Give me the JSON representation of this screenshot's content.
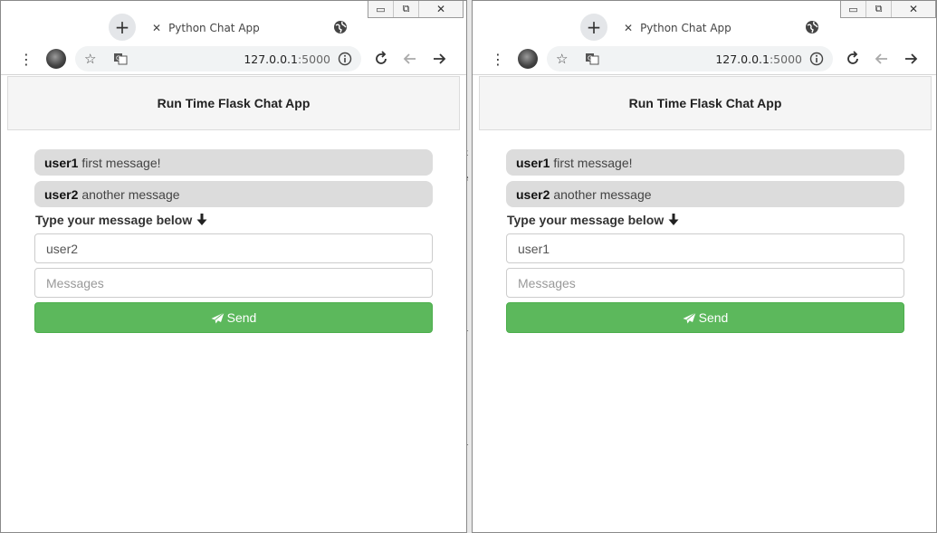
{
  "gap": {
    "ghost_text": [
      "k",
      "e",
      "1",
      "1"
    ]
  },
  "windows": [
    {
      "window_controls": {
        "minimize": "▭",
        "restore": "⧉",
        "close": "✕"
      },
      "tab": {
        "title": "Python Chat App",
        "close": "✕",
        "new_tab": "+"
      },
      "toolbar": {
        "url_host": "127.0.0.1",
        "url_port": ":5000",
        "menu": "⋮",
        "star": "☆"
      },
      "app": {
        "header": "Run Time Flask Chat App",
        "messages": [
          {
            "user": "user1",
            "text": "first message!"
          },
          {
            "user": "user2",
            "text": "another message"
          }
        ],
        "prompt": "Type your message below",
        "username_value": "user2",
        "message_placeholder": "Messages",
        "send_label": "Send"
      }
    },
    {
      "window_controls": {
        "minimize": "▭",
        "restore": "⧉",
        "close": "✕"
      },
      "tab": {
        "title": "Python Chat App",
        "close": "✕",
        "new_tab": "+"
      },
      "toolbar": {
        "url_host": "127.0.0.1",
        "url_port": ":5000",
        "menu": "⋮",
        "star": "☆"
      },
      "app": {
        "header": "Run Time Flask Chat App",
        "messages": [
          {
            "user": "user1",
            "text": "first message!"
          },
          {
            "user": "user2",
            "text": "another message"
          }
        ],
        "prompt": "Type your message below",
        "username_value": "user1",
        "message_placeholder": "Messages",
        "send_label": "Send"
      }
    }
  ],
  "colors": {
    "send_button": "#5cb85c",
    "message_bubble": "#dcdcdc",
    "header_bg": "#f5f5f5"
  },
  "icons": [
    "globe-icon",
    "translate-icon",
    "info-icon",
    "reload-icon",
    "back-arrow-icon",
    "forward-arrow-icon",
    "paper-plane-icon",
    "arrow-down-icon",
    "avatar"
  ]
}
